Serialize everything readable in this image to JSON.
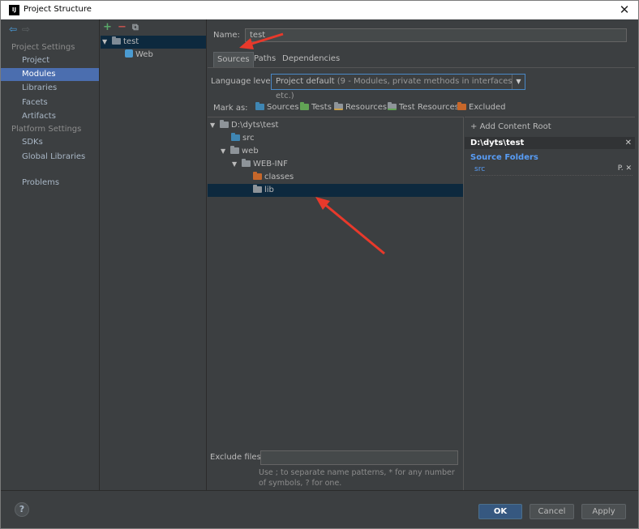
{
  "window": {
    "title": "Project Structure",
    "app_icon": "IJ"
  },
  "sidebar": {
    "project_settings_header": "Project Settings",
    "project_items": [
      "Project",
      "Modules",
      "Libraries",
      "Facets",
      "Artifacts"
    ],
    "platform_settings_header": "Platform Settings",
    "platform_items": [
      "SDKs",
      "Global Libraries"
    ],
    "problems": "Problems",
    "selected": "Modules"
  },
  "modules": {
    "module_name": "test",
    "facet_name": "Web"
  },
  "main": {
    "name_label": "Name:",
    "name_value": "test",
    "tabs": [
      "Sources",
      "Paths",
      "Dependencies"
    ],
    "active_tab": "Sources",
    "language_level_label": "Language level:",
    "language_level_main": "Project default",
    "language_level_detail": "(9 - Modules, private methods in interfaces etc.)",
    "mark_as_label": "Mark as:",
    "mark_as_options": [
      "Sources",
      "Tests",
      "Resources",
      "Test Resources",
      "Excluded"
    ],
    "tree": [
      "D:\\dyts\\test",
      "src",
      "web",
      "WEB-INF",
      "classes",
      "lib"
    ],
    "selected_tree_item": "lib",
    "add_content_root": "Add Content Root",
    "content_root": "D:\\dyts\\test",
    "source_folders_header": "Source Folders",
    "source_folders": [
      "src"
    ],
    "exclude_files_label": "Exclude files:",
    "exclude_files_value": "",
    "exclude_hint": "Use ; to separate name patterns, * for any number of symbols, ? for one."
  },
  "buttons": {
    "ok": "OK",
    "cancel": "Cancel",
    "apply": "Apply",
    "help": "?"
  },
  "colors": {
    "background": "#3c3f41",
    "selection": "#4b6eaf",
    "tree_selection": "#0d293e",
    "sources_folder": "#3f86b3",
    "tests_folder": "#62a455",
    "excluded_folder": "#c7672a",
    "annotation_arrow": "#e8392b"
  }
}
